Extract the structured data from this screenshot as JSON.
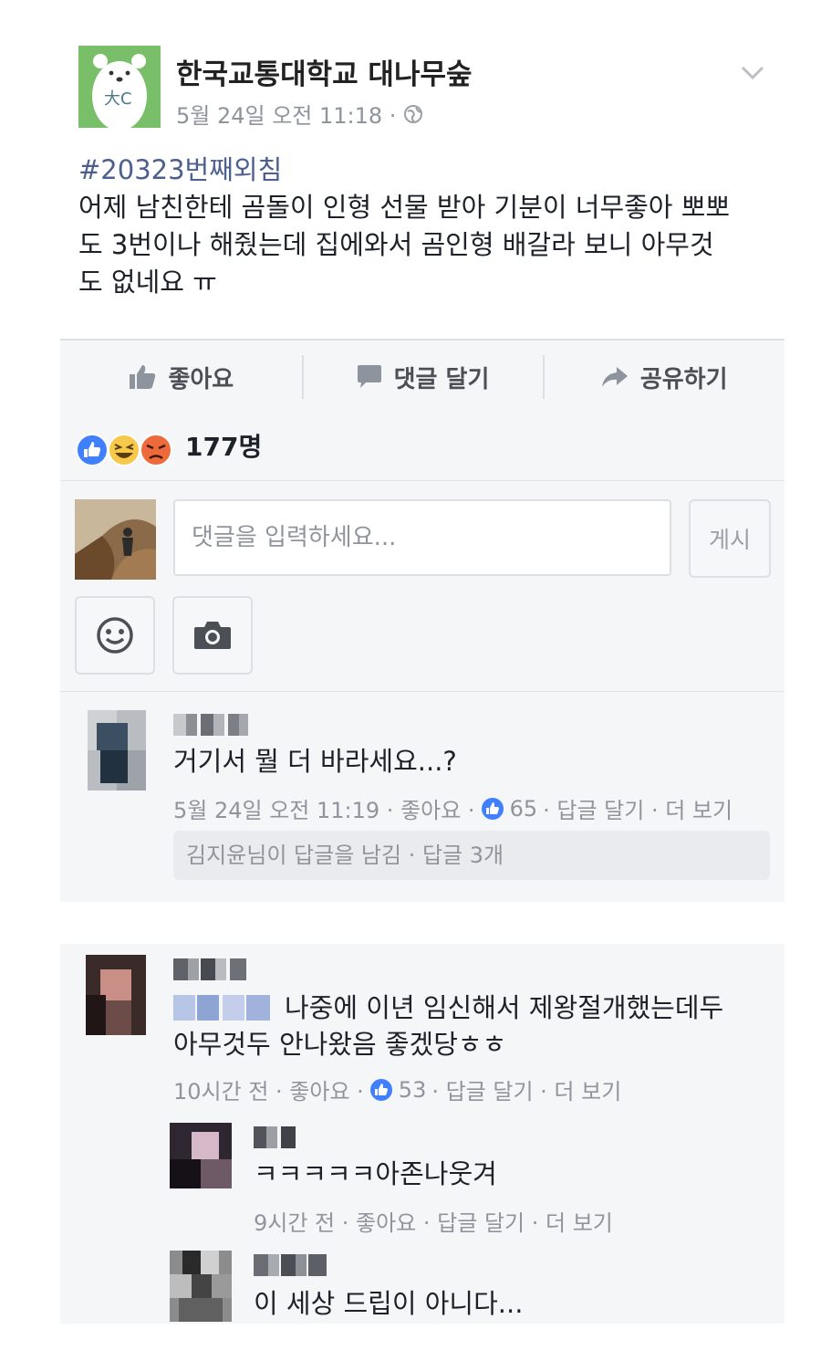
{
  "post": {
    "page_name": "한국교통대학교 대나무숲",
    "timestamp": "5월 24일 오전 11:18 ·",
    "logo_text": "大C",
    "hashtag": "#20323번째외침",
    "body_lines": [
      "어제 남친한테 곰돌이 인형 선물 받아 기분이 너무좋아 뽀뽀",
      "도 3번이나 해줬는데 집에와서 곰인형 배갈라 보니 아무것",
      "도 없네요 ㅠ"
    ]
  },
  "actions": {
    "like": "좋아요",
    "comment": "댓글 달기",
    "share": "공유하기"
  },
  "reactions": {
    "count": "177명",
    "icons": [
      "like-icon",
      "haha-icon",
      "angry-icon"
    ]
  },
  "composer": {
    "placeholder": "댓글을 입력하세요...",
    "post_button": "게시",
    "tools": [
      "smiley-icon",
      "camera-icon"
    ]
  },
  "comments": [
    {
      "text": "거기서 뭘 더 바라세요...?",
      "time": "5월 24일 오전 11:19 · 좋아요 ·",
      "likes": "65",
      "reply": "· 답글 달기 · 더 보기",
      "reply_summary": "김지윤님이 답글을 남김 · 답글 3개"
    },
    {
      "text_line1": "나중에 이년 임신해서 제왕절개했는데두",
      "text_line2": "아무것두 안나왔음 좋겠당ㅎㅎ",
      "time": "10시간 전 · 좋아요 ·",
      "likes": "53",
      "reply": "· 답글 달기 · 더 보기",
      "replies": [
        {
          "text": "ㅋㅋㅋㅋㅋ아존나웃겨",
          "meta": "9시간 전 · 좋아요 · 답글 달기 · 더 보기"
        },
        {
          "text": "이 세상 드립이 아니다..."
        }
      ]
    }
  ],
  "colors": {
    "link_blue": "#4c5f8f",
    "like_blue": "#4080ff",
    "grey_text": "#90949c",
    "panel_bg": "#f5f6f7",
    "logo_green": "#79bf6a"
  }
}
